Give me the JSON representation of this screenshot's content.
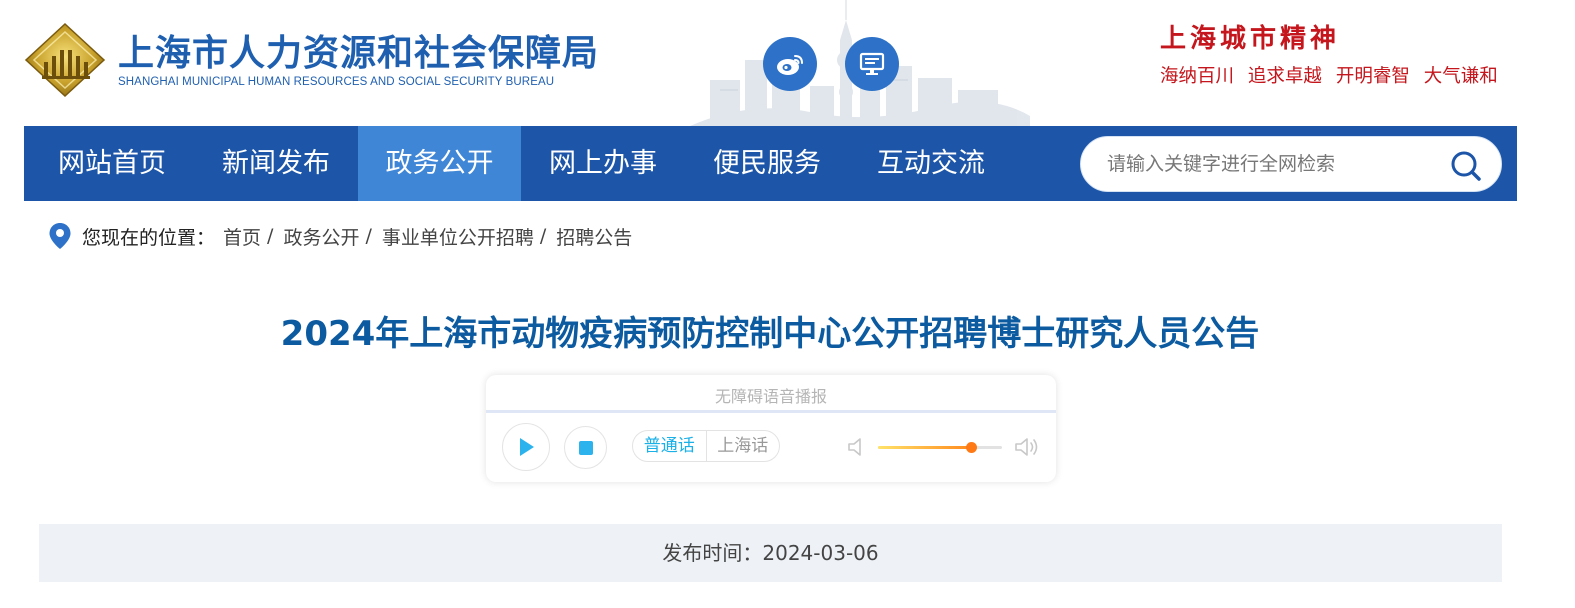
{
  "header": {
    "org_name_cn": "上海市人力资源和社会保障局",
    "org_name_en": "SHANGHAI MUNICIPAL HUMAN RESOURCES AND SOCIAL SECURITY BUREAU",
    "emblem_icon": "bureau-emblem-icon",
    "weibo_icon": "weibo-icon",
    "pc_icon": "desktop-monitor-icon",
    "brand_color": "#1f5fb0",
    "spirit": {
      "title": "上海城市精神",
      "phrases": [
        "海纳百川",
        "追求卓越",
        "开明睿智",
        "大气谦和"
      ],
      "color": "#c4161c"
    }
  },
  "nav": {
    "items": [
      {
        "label": "网站首页",
        "active": false
      },
      {
        "label": "新闻发布",
        "active": false
      },
      {
        "label": "政务公开",
        "active": true
      },
      {
        "label": "网上办事",
        "active": false
      },
      {
        "label": "便民服务",
        "active": false
      },
      {
        "label": "互动交流",
        "active": false
      }
    ],
    "bg_color": "#1d56a8",
    "active_color": "#3f86d6",
    "search": {
      "placeholder": "请输入关键字进行全网检索",
      "icon": "search-icon"
    }
  },
  "breadcrumb": {
    "icon": "location-pin-icon",
    "label": "您现在的位置：",
    "items": [
      "首页",
      "政务公开",
      "事业单位公开招聘",
      "招聘公告"
    ],
    "separator": "/"
  },
  "article": {
    "title": "2024年上海市动物疫病预防控制中心公开招聘博士研究人员公告",
    "title_color": "#0c5aa0",
    "publish_label": "发布时间：",
    "publish_date": "2024-03-06"
  },
  "player": {
    "title": "无障碍语音播报",
    "play_icon": "play-icon",
    "stop_icon": "stop-icon",
    "languages": [
      {
        "label": "普通话",
        "active": true
      },
      {
        "label": "上海话",
        "active": false
      }
    ],
    "progress": 0.0,
    "volume": 0.75,
    "volume_low_icon": "volume-low-icon",
    "volume_high_icon": "volume-high-icon"
  }
}
